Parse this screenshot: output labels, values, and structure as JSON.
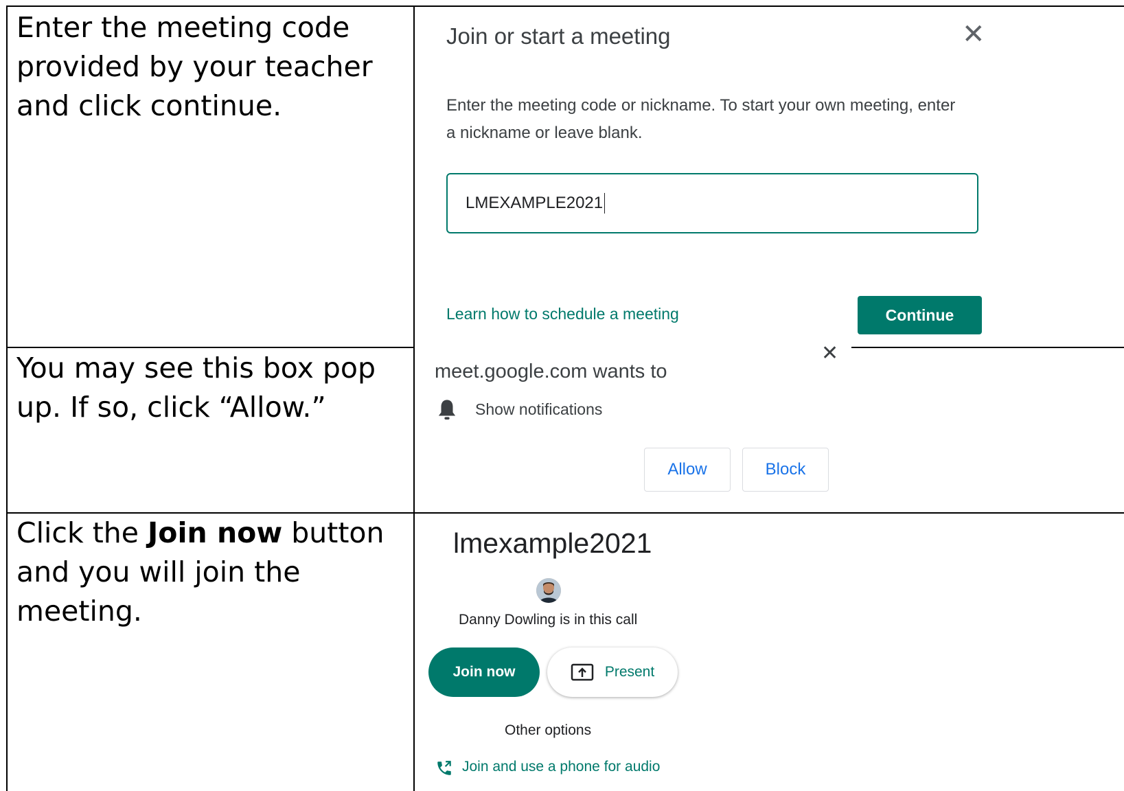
{
  "rows": [
    {
      "instruction": "Enter the meeting code provided by your teacher and click continue."
    },
    {
      "instruction": "You may see this box pop up. If so, click “Allow.”"
    },
    {
      "instruction_prefix": "Click the ",
      "instruction_bold": "Join now",
      "instruction_suffix": " button and you will join the meeting."
    }
  ],
  "join_dialog": {
    "title": "Join or start a meeting",
    "close_icon": "close-icon",
    "description": "Enter the meeting code or nickname. To start your own meeting, enter a nickname or leave blank.",
    "code_value": "LMEXAMPLE2021",
    "learn_link": "Learn how to schedule a meeting",
    "continue_label": "Continue",
    "accent_color": "#00796b"
  },
  "permission_prompt": {
    "title": "meet.google.com wants to",
    "notification_icon": "bell-icon",
    "notification_text": "Show notifications",
    "allow_label": "Allow",
    "block_label": "Block",
    "button_color": "#1a73e8"
  },
  "join_screen": {
    "room_name": "lmexample2021",
    "in_call_text": "Danny Dowling is in this call",
    "join_label": "Join now",
    "present_label": "Present",
    "other_options": "Other options",
    "phone_link": "Join and use a phone for audio"
  }
}
